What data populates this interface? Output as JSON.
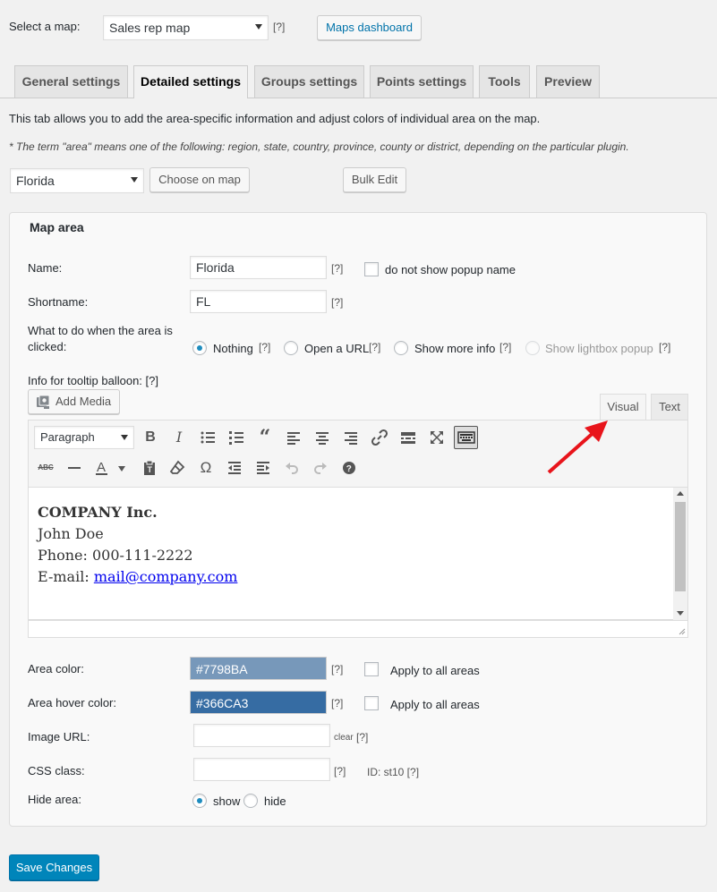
{
  "top": {
    "select_map_label": "Select a map:",
    "map_select_value": "Sales rep map",
    "help": "[?]",
    "dashboard_button": "Maps dashboard"
  },
  "tabs": [
    {
      "label": "General settings",
      "active": false
    },
    {
      "label": "Detailed settings",
      "active": true
    },
    {
      "label": "Groups settings",
      "active": false
    },
    {
      "label": "Points settings",
      "active": false
    },
    {
      "label": "Tools",
      "active": false
    },
    {
      "label": "Preview",
      "active": false
    }
  ],
  "intro": {
    "line1": "This tab allows you to add the area-specific information and adjust colors of individual area on the map.",
    "line2": "* The term \"area\" means one of the following: region, state, country, province, county or district, depending on the particular plugin."
  },
  "area_picker": {
    "area_select_value": "Florida",
    "choose_button": "Choose on map",
    "bulk_button": "Bulk Edit"
  },
  "map_area": {
    "legend": "Map area",
    "name_label": "Name:",
    "name_value": "Florida",
    "no_popup_label": "do not show popup name",
    "shortname_label": "Shortname:",
    "shortname_value": "FL",
    "click_label_line1": "What to do when the area is",
    "click_label_line2": "clicked:",
    "click_options": [
      {
        "label": "Nothing",
        "help": "[?]",
        "checked": true,
        "disabled": false
      },
      {
        "label": "Open a URL",
        "help": "[?]",
        "checked": false,
        "disabled": false
      },
      {
        "label": "Show more info",
        "help": "[?]",
        "checked": false,
        "disabled": false
      },
      {
        "label": "Show lightbox popup",
        "help": "[?]",
        "checked": false,
        "disabled": true
      }
    ],
    "tooltip_label": "Info for tooltip balloon: [?]",
    "add_media": "Add Media",
    "editor_tabs": {
      "visual": "Visual",
      "text": "Text"
    },
    "paragraph_select": "Paragraph",
    "content": {
      "company": "COMPANY Inc.",
      "person": "John Doe",
      "phone": "Phone: 000-111-2222",
      "email_prefix": "E-mail: ",
      "email_link": "mail@company.com"
    },
    "area_color_label": "Area color:",
    "area_color_value": "#7798BA",
    "area_hover_label": "Area hover color:",
    "area_hover_value": "#366CA3",
    "apply_all_label": "Apply to all areas",
    "image_url_label": "Image URL:",
    "image_url_value": "",
    "clear_label": "clear",
    "css_class_label": "CSS class:",
    "css_class_value": "",
    "id_label": "ID: st10 [?]",
    "hide_area_label": "Hide area:",
    "hide_options": [
      {
        "label": "show",
        "checked": true
      },
      {
        "label": "hide",
        "checked": false
      }
    ]
  },
  "save_button": "Save Changes",
  "colors": {
    "area_color": "#7798BA",
    "area_hover_color": "#366CA3",
    "primary_button": "#0085BA",
    "annotation_arrow": "#E8141B"
  }
}
